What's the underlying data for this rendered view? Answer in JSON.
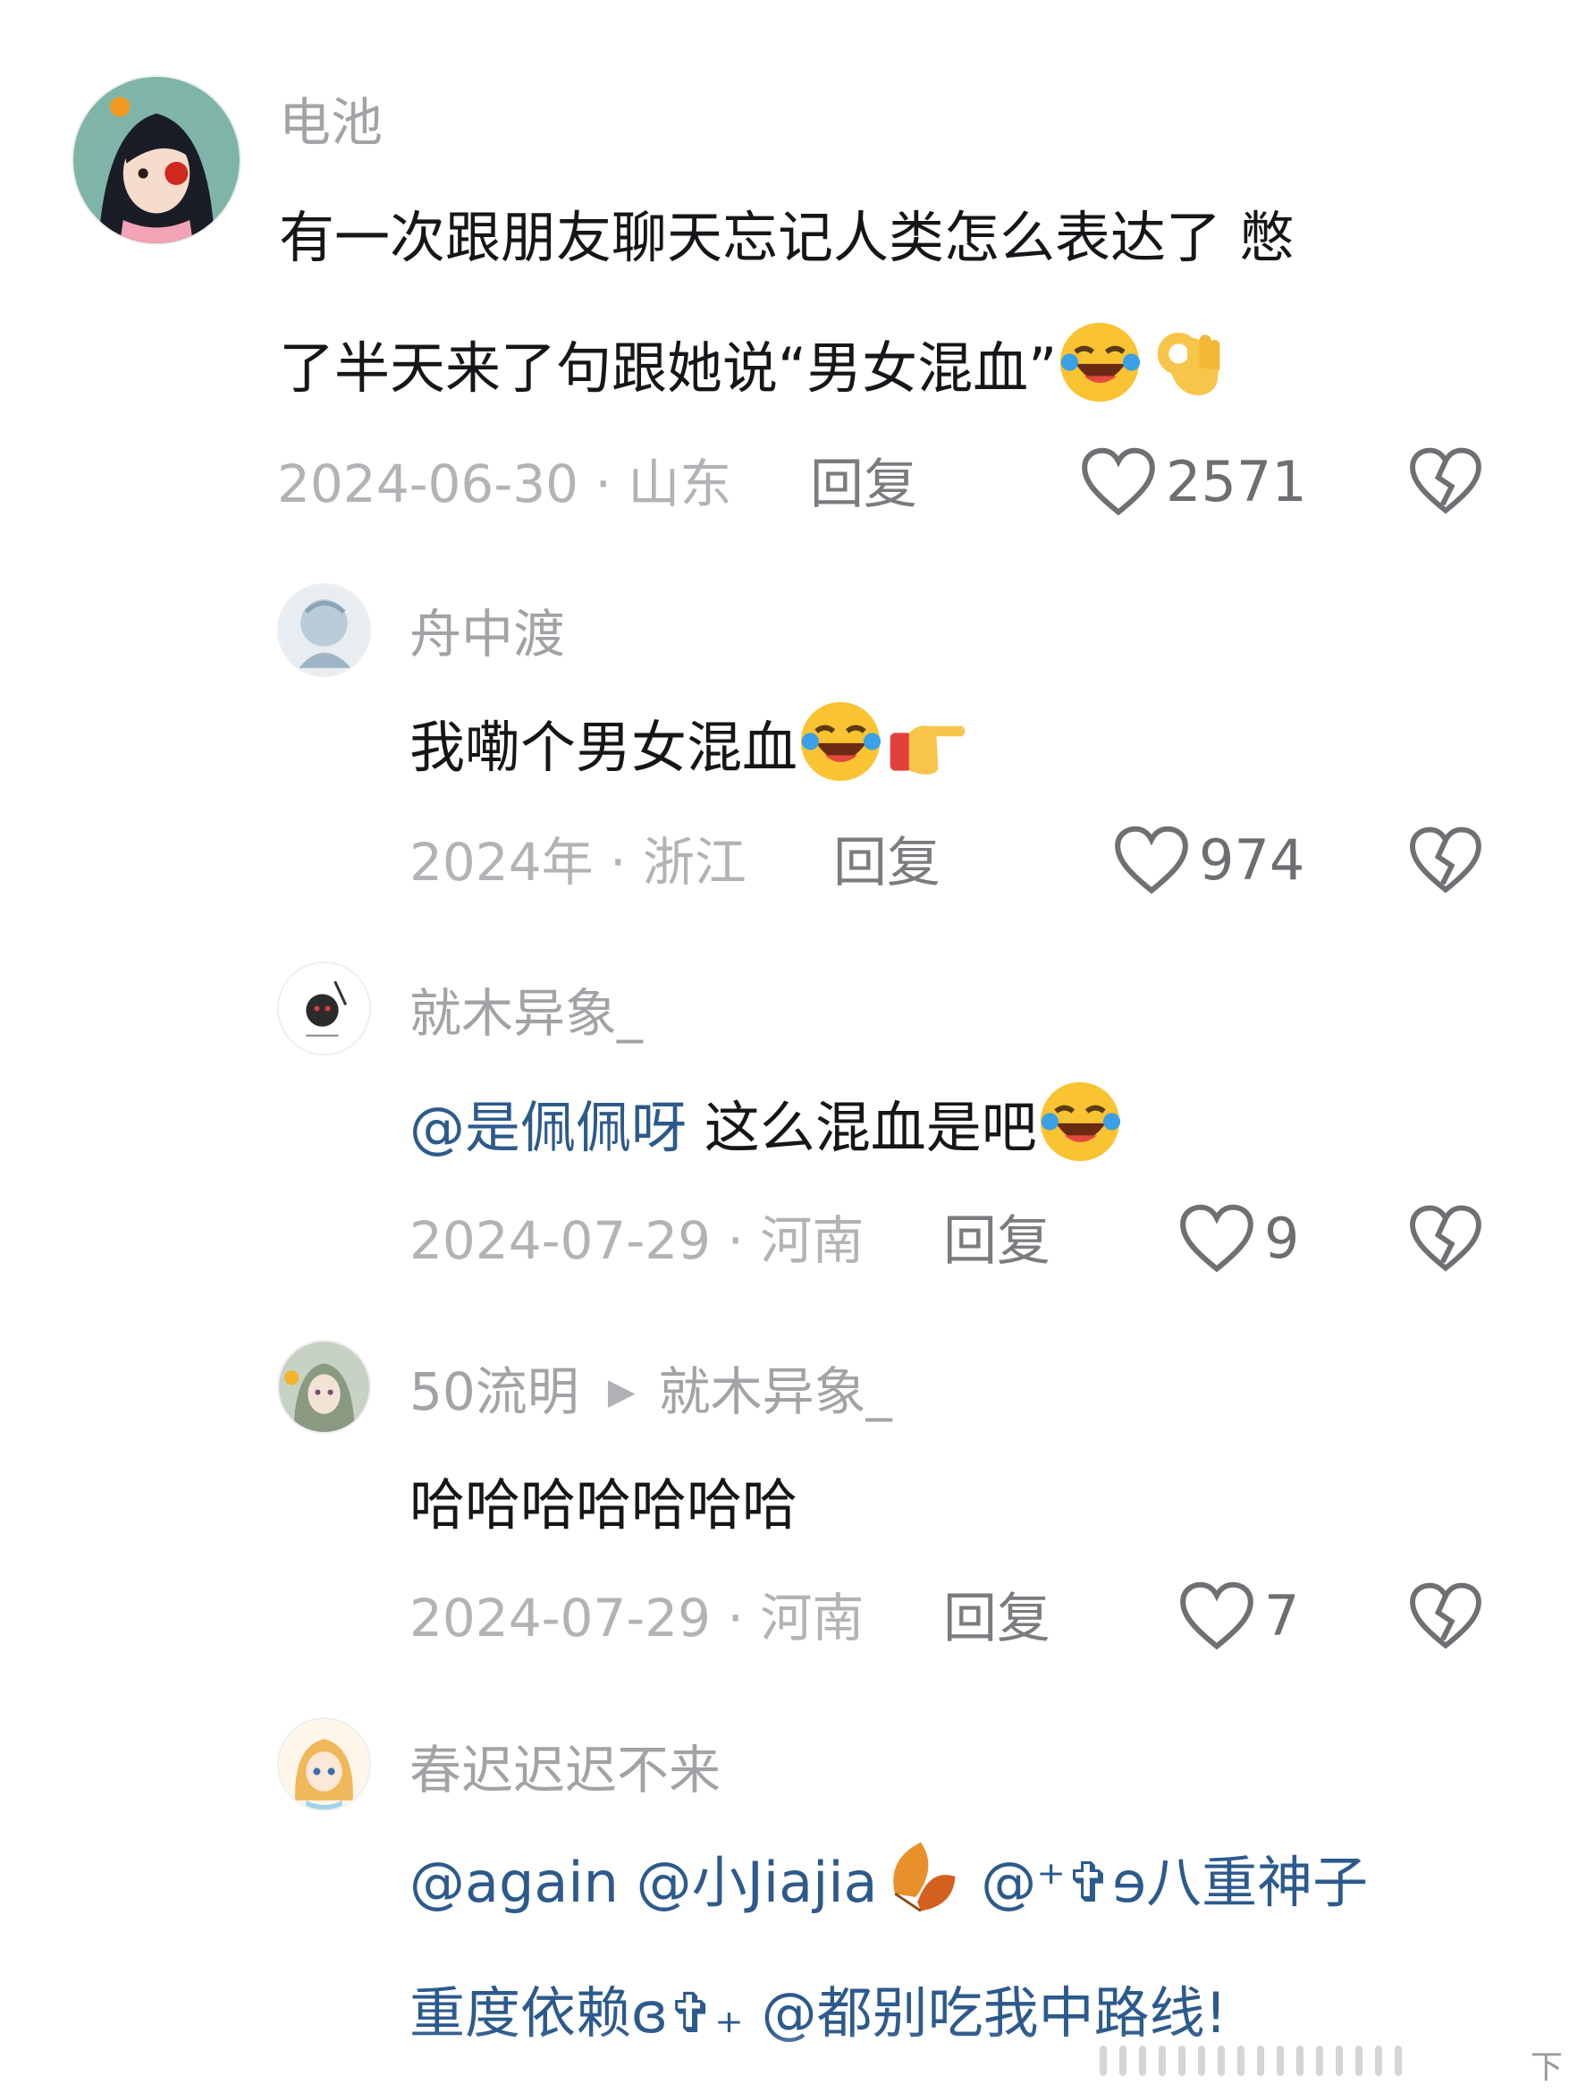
{
  "comments": [
    {
      "username": "电池",
      "lines": [
        "有一次跟朋友聊天忘记人类怎么表达了 憋",
        "了半天来了句跟她说“男女混血”"
      ],
      "line2_emojis": [
        "rofl-emoji",
        "ok-hand-emoji"
      ],
      "meta": "2024-06-30 · 山东",
      "reply_label": "回复",
      "likes": "2571"
    },
    {
      "username": "舟中渡",
      "text": "我嘞个男女混血",
      "emojis": [
        "rofl-emoji",
        "pointing-hand-emoji"
      ],
      "meta": "2024年 · 浙江",
      "reply_label": "回复",
      "likes": "974"
    },
    {
      "username": "就木异象_",
      "mention": "@是佩佩呀",
      "text": " 这么混血是吧",
      "emojis": [
        "rofl-emoji"
      ],
      "meta": "2024-07-29 · 河南",
      "reply_label": "回复",
      "likes": "9"
    },
    {
      "username": "50流明",
      "reply_to": "就木异象_",
      "text": "哈哈哈哈哈哈哈",
      "meta": "2024-07-29 · 河南",
      "reply_label": "回复",
      "likes": "7"
    },
    {
      "username": "春迟迟迟不来",
      "line1_mentions": [
        "@again",
        "@小Jiajia",
        "@⁺✞ɘ八重神子"
      ],
      "line2_mentions": [
        "重度依赖ɞ✞₊",
        "@都别吃我中路线!"
      ]
    }
  ],
  "watermark": "下"
}
